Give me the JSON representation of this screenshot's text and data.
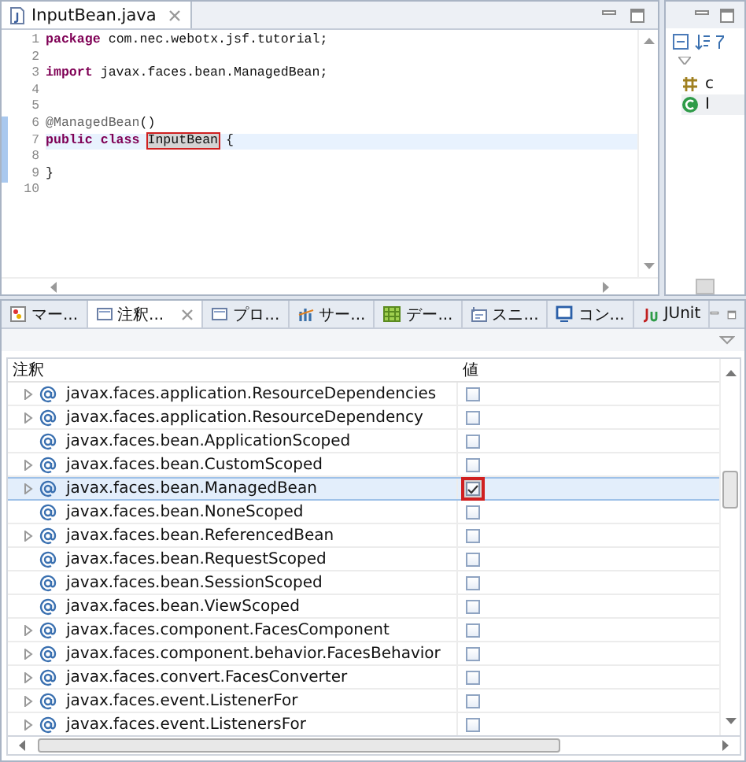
{
  "editor": {
    "tab": {
      "title": "InputBean.java",
      "selected": true
    },
    "lines": [
      {
        "number": "1",
        "changed": false,
        "current": false,
        "tokens": [
          {
            "kind": "keyword",
            "text": "package"
          },
          {
            "kind": "plain",
            "text": " com.nec.webotx.jsf.tutorial;"
          }
        ]
      },
      {
        "number": "2",
        "changed": false,
        "current": false
      },
      {
        "number": "3",
        "changed": false,
        "current": false,
        "tokens": [
          {
            "kind": "keyword",
            "text": "import"
          },
          {
            "kind": "plain",
            "text": " javax.faces.bean.ManagedBean;"
          }
        ]
      },
      {
        "number": "4",
        "changed": false,
        "current": false
      },
      {
        "number": "5",
        "changed": false,
        "current": false
      },
      {
        "number": "6",
        "changed": true,
        "current": false,
        "tokens": [
          {
            "kind": "annotation",
            "text": "@ManagedBean"
          },
          {
            "kind": "plain",
            "text": "()"
          }
        ]
      },
      {
        "number": "7",
        "changed": true,
        "current": true,
        "tokens": [
          {
            "kind": "keyword",
            "text": "public"
          },
          {
            "kind": "keyword",
            "text": "class",
            "space_before": true
          },
          {
            "kind": "marked",
            "text": "InputBean",
            "space_before": true
          },
          {
            "kind": "plain",
            "text": "{",
            "space_before": true
          }
        ]
      },
      {
        "number": "8",
        "changed": true,
        "current": false
      },
      {
        "number": "9",
        "changed": true,
        "current": false,
        "tokens": [
          {
            "kind": "plain",
            "text": "}"
          }
        ]
      },
      {
        "number": "10",
        "changed": false,
        "current": false
      }
    ]
  },
  "outline": {
    "items": [
      {
        "kind": "package",
        "label": "c"
      },
      {
        "kind": "class",
        "label": "I"
      }
    ]
  },
  "bottom_tabs": [
    {
      "kind": "markers",
      "label": "マー...",
      "selected": false
    },
    {
      "kind": "view",
      "label": "注釈...",
      "selected": true
    },
    {
      "kind": "view",
      "label": "プロ...",
      "selected": false
    },
    {
      "kind": "servers",
      "label": "サー...",
      "selected": false
    },
    {
      "kind": "data",
      "label": "デー...",
      "selected": false
    },
    {
      "kind": "snippets",
      "label": "スニ...",
      "selected": false
    },
    {
      "kind": "console",
      "label": "コン...",
      "selected": false
    },
    {
      "kind": "junit",
      "label": "JUnit",
      "selected": false
    }
  ],
  "table": {
    "columns": [
      "注釈",
      "値"
    ],
    "rows": [
      {
        "name": "javax.faces.application.ResourceDependencies",
        "expandable": true,
        "checked": false,
        "selected": false
      },
      {
        "name": "javax.faces.application.ResourceDependency",
        "expandable": true,
        "checked": false,
        "selected": false
      },
      {
        "name": "javax.faces.bean.ApplicationScoped",
        "expandable": false,
        "checked": false,
        "selected": false
      },
      {
        "name": "javax.faces.bean.CustomScoped",
        "expandable": true,
        "checked": false,
        "selected": false
      },
      {
        "name": "javax.faces.bean.ManagedBean",
        "expandable": true,
        "checked": true,
        "selected": true
      },
      {
        "name": "javax.faces.bean.NoneScoped",
        "expandable": false,
        "checked": false,
        "selected": false
      },
      {
        "name": "javax.faces.bean.ReferencedBean",
        "expandable": true,
        "checked": false,
        "selected": false
      },
      {
        "name": "javax.faces.bean.RequestScoped",
        "expandable": false,
        "checked": false,
        "selected": false
      },
      {
        "name": "javax.faces.bean.SessionScoped",
        "expandable": false,
        "checked": false,
        "selected": false
      },
      {
        "name": "javax.faces.bean.ViewScoped",
        "expandable": false,
        "checked": false,
        "selected": false
      },
      {
        "name": "javax.faces.component.FacesComponent",
        "expandable": true,
        "checked": false,
        "selected": false
      },
      {
        "name": "javax.faces.component.behavior.FacesBehavior",
        "expandable": true,
        "checked": false,
        "selected": false
      },
      {
        "name": "javax.faces.convert.FacesConverter",
        "expandable": true,
        "checked": false,
        "selected": false
      },
      {
        "name": "javax.faces.event.ListenerFor",
        "expandable": true,
        "checked": false,
        "selected": false
      },
      {
        "name": "javax.faces.event.ListenersFor",
        "expandable": true,
        "checked": false,
        "selected": false
      }
    ]
  }
}
